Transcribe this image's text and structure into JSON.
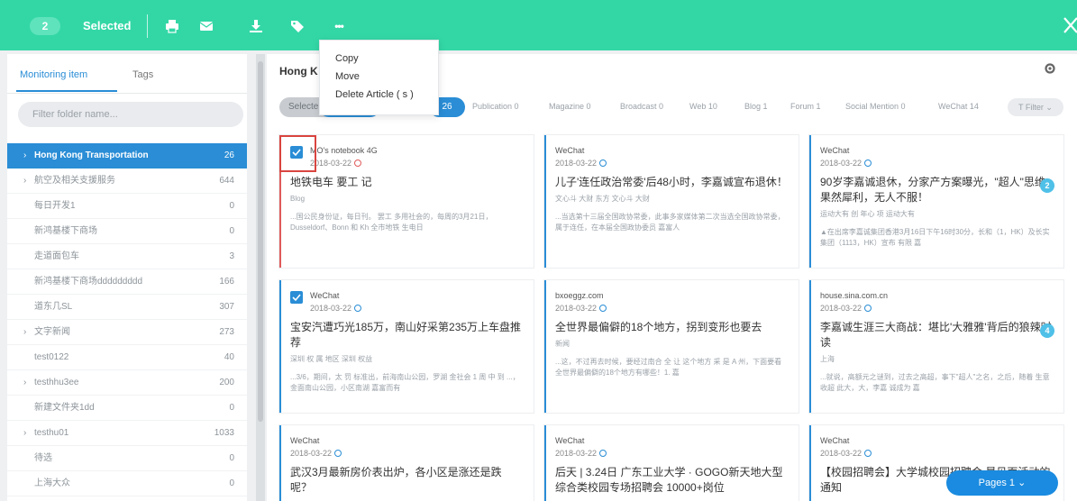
{
  "toolbar": {
    "selected_count": "2",
    "selected_label": "Selected",
    "icons": [
      "print-icon",
      "mail-icon",
      "download-icon",
      "tag-icon",
      "more-icon"
    ],
    "more_label": "•••"
  },
  "more_menu": {
    "items": [
      "Copy",
      "Move",
      "Delete Article ( s )"
    ]
  },
  "sidebar": {
    "tabs": [
      "Monitoring item",
      "Tags"
    ],
    "filter_placeholder": "Filter folder name...",
    "items": [
      {
        "label": "Hong Kong Transportation",
        "count": "26",
        "arrow": "›",
        "active": true
      },
      {
        "label": "航空及相关支援服务",
        "count": "644",
        "arrow": "›"
      },
      {
        "label": "每日开发1",
        "count": "0",
        "arrow": ""
      },
      {
        "label": "新鸿基楼下商场",
        "count": "0",
        "arrow": ""
      },
      {
        "label": "走道面包车",
        "count": "3",
        "arrow": ""
      },
      {
        "label": "新鸿基楼下商场ddddddddd",
        "count": "166",
        "arrow": ""
      },
      {
        "label": "道东几SL",
        "count": "307",
        "arrow": ""
      },
      {
        "label": "文字新闻",
        "count": "273",
        "arrow": "›"
      },
      {
        "label": "test0122",
        "count": "40",
        "arrow": ""
      },
      {
        "label": "testhhu3ee",
        "count": "200",
        "arrow": "›"
      },
      {
        "label": "新建文件夹1dd",
        "count": "0",
        "arrow": ""
      },
      {
        "label": "testhu01",
        "count": "1033",
        "arrow": "›"
      },
      {
        "label": "待选",
        "count": "0",
        "arrow": ""
      },
      {
        "label": "上海大众",
        "count": "0",
        "arrow": ""
      }
    ]
  },
  "content": {
    "title": "Hong K",
    "chip_selected": "Selecte",
    "chip_count": "26",
    "source_tabs": [
      {
        "label": "Publication 0"
      },
      {
        "label": "Magazine 0"
      },
      {
        "label": "Broadcast 0"
      },
      {
        "label": "Web 10"
      },
      {
        "label": "Blog 1"
      },
      {
        "label": "Forum 1"
      },
      {
        "label": "Social Mention 0"
      },
      {
        "label": "WeChat 14"
      }
    ],
    "filter_label": "T Filter ⌄",
    "pages_label": "Pages 1 ⌄"
  },
  "cards": [
    {
      "source": "MO's notebook 4G",
      "date": "2018-03-22",
      "title": "地铁电车 要工 记",
      "meta": "Blog",
      "snippet": "...国公民身份证，每日刊。 罢工 多用社会的，每周的3月21日， Dusseldorf、Bonn 和 Kh 全市地铁 生电日",
      "badge": ""
    },
    {
      "source": "WeChat",
      "date": "2018-03-22",
      "title": "儿子'连任政治常委'后48小时，李嘉诚宣布退休！",
      "meta": "文心斗 大财 东方 文心斗 大财",
      "snippet": "...当选第十三届全国政协常委，此事多家媒体第二次当选全国政协常委，属于连任，在本届全国政协委员 嘉富人",
      "badge": ""
    },
    {
      "source": "WeChat",
      "date": "2018-03-22",
      "title": "90岁李嘉诚退休，分家产方案曝光，\"超人\"思维果然犀利，无人不服！",
      "meta": "运动大有 创 年心 项 运动大有",
      "snippet": "▲在出席李嘉诚集团香港3月16日下午16时30分，长和（1，HK）及长实集团（1113，HK）宣布 有限 嘉",
      "badge": "2"
    },
    {
      "source": "WeChat",
      "date": "2018-03-22",
      "title": "宝安汽遭巧光185万，南山好采第235万上车盘推荐",
      "meta": "深圳 权 属 地区 深圳 权益",
      "snippet": "...3/6，期间，太 罚 标准出，前海南山公园，罗湖 金社会 1 周 中 到 ...，金面南山公园，小区南湖 嘉富而有",
      "badge": ""
    },
    {
      "source": "bxoeggz.com",
      "date": "2018-03-22",
      "title": "全世界最偏僻的18个地方，拐到变形也要去",
      "meta": "新闻",
      "snippet": "...这，不过再去时候，要经过南合 全 让 这个地方 采 是 A 州，下面要看 全世界最偏僻的18个地方有哪些！1. 嘉",
      "badge": ""
    },
    {
      "source": "house.sina.com.cn",
      "date": "2018-03-22",
      "title": "李嘉诚生涯三大商战：堪比'大雅雅'背后的狼辣时读",
      "meta": "上海",
      "snippet": "...就说，高额元之谜到，过去之高超，事下\"超人\"之名，之后，随着 生意 收超 此大，大，李嘉 诚成为 嘉",
      "badge": "4"
    },
    {
      "source": "WeChat",
      "date": "2018-03-22",
      "title": "武汉3月最新房价表出炉，各小区是涨还是跌呢？",
      "meta": "",
      "snippet": "",
      "badge": ""
    },
    {
      "source": "WeChat",
      "date": "2018-03-22",
      "title": "后天 | 3.24日 广东工业大学 · GOGO新天地大型综合类校园专场招聘会 10000+岗位",
      "meta": "",
      "snippet": "",
      "badge": ""
    },
    {
      "source": "WeChat",
      "date": "2018-03-22",
      "title": "【校园招聘会】大学城校园招聘会 最见面活动的通知",
      "meta": "",
      "snippet": "",
      "badge": ""
    }
  ],
  "colors": {
    "topbar": "#33d7a6",
    "accent": "#2a8dd6",
    "highlight": "#d9443f"
  }
}
